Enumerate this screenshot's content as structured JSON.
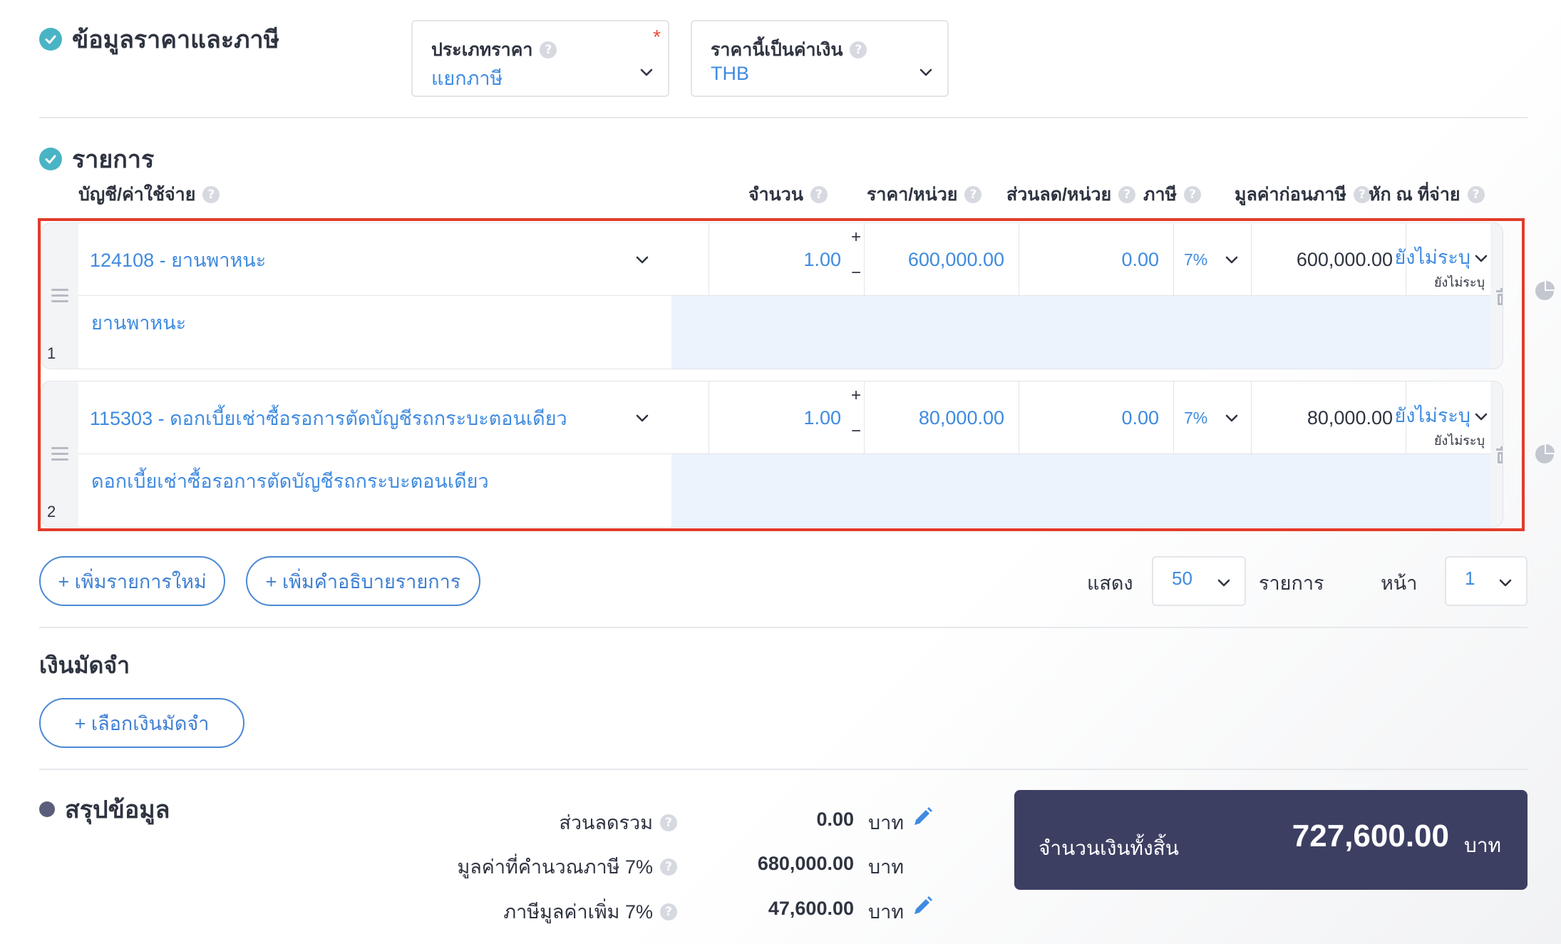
{
  "price_tax": {
    "title": "ข้อมูลราคาและภาษี",
    "price_type": {
      "label": "ประเภทราคา",
      "value": "แยกภาษี",
      "required_mark": "*"
    },
    "currency": {
      "label": "ราคานี้เป็นค่าเงิน",
      "value": "THB"
    }
  },
  "items": {
    "title": "รายการ",
    "columns": {
      "account": "บัญชี/ค่าใช้จ่าย",
      "quantity": "จำนวน",
      "unit_price": "ราคา/หน่วย",
      "discount": "ส่วนลด/หน่วย",
      "tax": "ภาษี",
      "pre_tax": "มูลค่าก่อนภาษี",
      "withholding": "หัก ณ ที่จ่าย"
    },
    "rows": [
      {
        "num": "1",
        "account": "124108 - ยานพาหนะ",
        "description": "ยานพาหนะ",
        "quantity": "1.00",
        "unit_price": "600,000.00",
        "discount": "0.00",
        "tax": "7%",
        "pre_tax": "600,000.00",
        "withholding": "ยังไม่ระบุ",
        "withholding_sub": "ยังไม่ระบุ"
      },
      {
        "num": "2",
        "account": "115303 - ดอกเบี้ยเช่าซื้อรอการตัดบัญชีรถกระบะตอนเดียว",
        "description": "ดอกเบี้ยเช่าซื้อรอการตัดบัญชีรถกระบะตอนเดียว",
        "quantity": "1.00",
        "unit_price": "80,000.00",
        "discount": "0.00",
        "tax": "7%",
        "pre_tax": "80,000.00",
        "withholding": "ยังไม่ระบุ",
        "withholding_sub": "ยังไม่ระบุ"
      }
    ],
    "plus": "+",
    "minus": "−",
    "add_item": "+ เพิ่มรายการใหม่",
    "add_description": "+ เพิ่มคำอธิบายรายการ",
    "show_label": "แสดง",
    "page_size": "50",
    "items_label": "รายการ",
    "page_label": "หน้า",
    "page": "1"
  },
  "deposit": {
    "title": "เงินมัดจำ",
    "select_button": "+ เลือกเงินมัดจำ"
  },
  "summary": {
    "title": "สรุปข้อมูล",
    "discount_label": "ส่วนลดรวม",
    "discount_value": "0.00",
    "taxable_label": "มูลค่าที่คำนวณภาษี 7%",
    "taxable_value": "680,000.00",
    "vat_label": "ภาษีมูลค่าเพิ่ม 7%",
    "vat_value": "47,600.00",
    "unit": "บาท",
    "total_label": "จำนวนเงินทั้งสิ้น",
    "total_value": "727,600.00",
    "total_unit": "บาท"
  },
  "colors": {
    "accent": "#3f8be0",
    "check": "#49b4c4",
    "highlight": "#e23b2a",
    "total_bg": "#3d3f62"
  }
}
